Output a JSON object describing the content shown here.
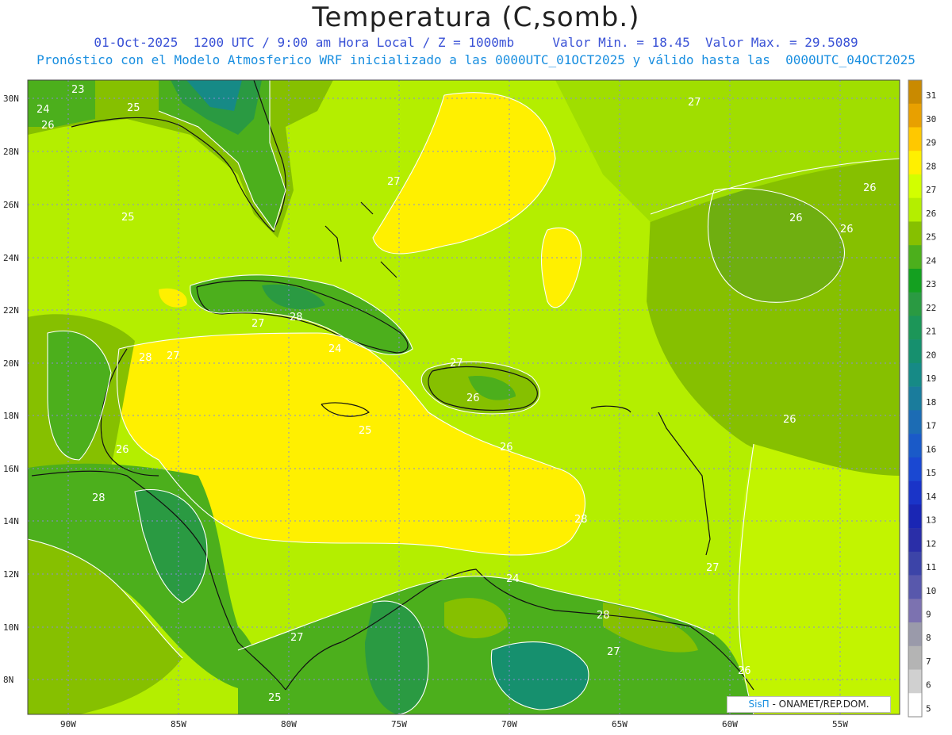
{
  "title": "Temperatura (C,somb.)",
  "subtitle1": "01-Oct-2025  1200 UTC / 9:00 am Hora Local / Z = 1000mb     Valor Min. = 18.45  Valor Max. = 29.5089",
  "subtitle2": "Pronóstico con el Modelo Atmosferico WRF inicializado a las 0000UTC_01OCT2025 y válido hasta las  0000UTC_04OCT2025",
  "lon_labels": [
    "90W",
    "85W",
    "80W",
    "75W",
    "70W",
    "65W",
    "60W",
    "55W"
  ],
  "lat_labels": [
    "30N",
    "28N",
    "26N",
    "24N",
    "22N",
    "20N",
    "18N",
    "16N",
    "14N",
    "12N",
    "10N",
    "8N"
  ],
  "colorbar": {
    "labels": [
      "31",
      "30",
      "29",
      "28",
      "27",
      "26",
      "25",
      "24",
      "23",
      "22",
      "21",
      "20",
      "19",
      "18",
      "17",
      "16",
      "15",
      "14",
      "13",
      "12",
      "11",
      "10",
      "9",
      "8",
      "7",
      "6",
      "5"
    ],
    "colors": [
      "#c98a00",
      "#e8a000",
      "#ffc800",
      "#fff000",
      "#d2ff00",
      "#b4ee00",
      "#86c000",
      "#4caf1c",
      "#14a020",
      "#2a9a42",
      "#1c9658",
      "#16906e",
      "#168a86",
      "#1a7c9c",
      "#1c6cb4",
      "#1a5ac8",
      "#1a48d2",
      "#1a34c8",
      "#1a26b4",
      "#2a2ea8",
      "#3c44a8",
      "#5858ac",
      "#7c72b0",
      "#9a9aaa",
      "#b4b4b4",
      "#d0d0d0",
      "#ffffff"
    ]
  },
  "contour_labels": [
    "23",
    "24",
    "26",
    "25",
    "27",
    "26",
    "26",
    "26",
    "27",
    "25",
    "27",
    "28",
    "28",
    "27",
    "27",
    "26",
    "25",
    "26",
    "26",
    "28",
    "28",
    "24",
    "28",
    "27",
    "27",
    "26",
    "25",
    "26",
    "24",
    "27"
  ],
  "credit": {
    "sis": "SisΠ",
    "rest": " - ONAMET/REP.DOM."
  },
  "colors": {
    "subtitle1": "#3a52d6",
    "subtitle2": "#1a8fe0"
  }
}
